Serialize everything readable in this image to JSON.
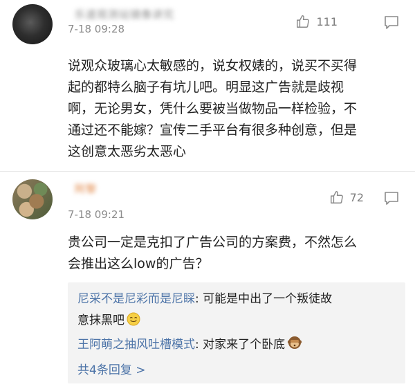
{
  "comments": [
    {
      "username": "乐道观测站镜像讲究",
      "timestamp": "7-18 09:28",
      "likes": "111",
      "body_lines": [
        "说观众玻璃心太敏感的，说女权婊的，说买不买得",
        "起的都特么脑子有坑儿吧。明显这广告就是歧视",
        "啊，无论男女，凭什么要被当做物品一样检验，不",
        "通过还不能嫁？宣传二手平台有很多种创意，但是",
        "这创意太恶劣太恶心"
      ]
    },
    {
      "username": "阿黎",
      "timestamp": "7-18 09:21",
      "likes": "72",
      "body_lines": [
        "贵公司一定是克扣了广告公司的方案费，不然怎么",
        "会推出这么low的广告？"
      ],
      "replies": [
        {
          "name": "尼采不是尼彩而是尼睬",
          "text_line1": ": 可能是中出了一个叛徒故",
          "text_line2": "意抹黑吧",
          "emoji": "smile-emoji"
        },
        {
          "name": "王阿萌之抽风吐槽模式",
          "text_line1": ": 对家来了个卧底",
          "emoji": "monkey-emoji"
        }
      ],
      "more_replies": "共4条回复 >"
    }
  ],
  "colors": {
    "link_blue": "#4d74a8",
    "meta_gray": "#8c8c8c",
    "reply_bg": "#f3f3f3"
  }
}
